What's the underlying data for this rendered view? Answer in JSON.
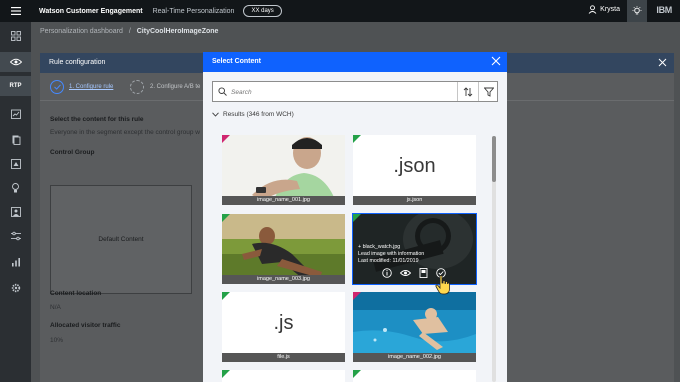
{
  "header": {
    "app_title": "Watson Customer Engagement",
    "section": "Real-Time Personalization",
    "pill": "XX days",
    "user": "Krysta",
    "brand": "IBM"
  },
  "sidebar": {
    "items": [
      {
        "icon": "dashboard-icon"
      },
      {
        "icon": "eye-icon",
        "active": true
      },
      {
        "label": "RTP",
        "active": true
      },
      {
        "icon": "chart-edit-icon"
      },
      {
        "icon": "document-icon"
      },
      {
        "icon": "content-icon"
      },
      {
        "icon": "lightbulb-icon"
      },
      {
        "icon": "image-icon"
      },
      {
        "icon": "sliders-icon"
      },
      {
        "icon": "bar-chart-icon"
      },
      {
        "icon": "settings-icon"
      }
    ]
  },
  "breadcrumb": {
    "parent": "Personalization dashboard",
    "separator": "/",
    "current": "CityCoolHeroImageZone"
  },
  "rule": {
    "title": "Rule configuration",
    "step1": "1. Configure rule",
    "step2": "2. Configure A/B te",
    "select_title": "Select the content for this rule",
    "select_desc": "Everyone in the segment except the control group w",
    "control_group": "Control Group",
    "default_content": "Default Content",
    "content_location_label": "Content location",
    "content_location_value": "N/A",
    "traffic_label": "Allocated visitor traffic",
    "traffic_value": "10%"
  },
  "modal": {
    "title": "Select Content",
    "search_placeholder": "Search",
    "results": "Results (346 from WCH)",
    "cards": [
      {
        "caption": "image_name_001.jpg",
        "type": "image",
        "tag": "pink"
      },
      {
        "caption": "js.json",
        "type": "file",
        "ext": ".json",
        "tag": "green"
      },
      {
        "caption": "image_name_003.jpg",
        "type": "image",
        "tag": "green"
      },
      {
        "caption": "black_watch.jpg",
        "type": "image",
        "tag": "green",
        "selected": true,
        "overlay": {
          "name": "+ black_watch.jpg",
          "desc": "Lead image with information",
          "modified": "Last modified: 11/01/2019"
        }
      },
      {
        "caption": "file.js",
        "type": "file",
        "ext": ".js",
        "tag": "green"
      },
      {
        "caption": "image_name_002.jpg",
        "type": "image",
        "tag": "pink"
      },
      {
        "caption": "",
        "type": "file",
        "tag": "green"
      },
      {
        "caption": "",
        "type": "file",
        "tag": "green"
      }
    ]
  },
  "colors": {
    "primary": "#0f62fe",
    "tag_pink": "#d02670",
    "tag_green": "#24a148",
    "topbar": "#121619"
  }
}
